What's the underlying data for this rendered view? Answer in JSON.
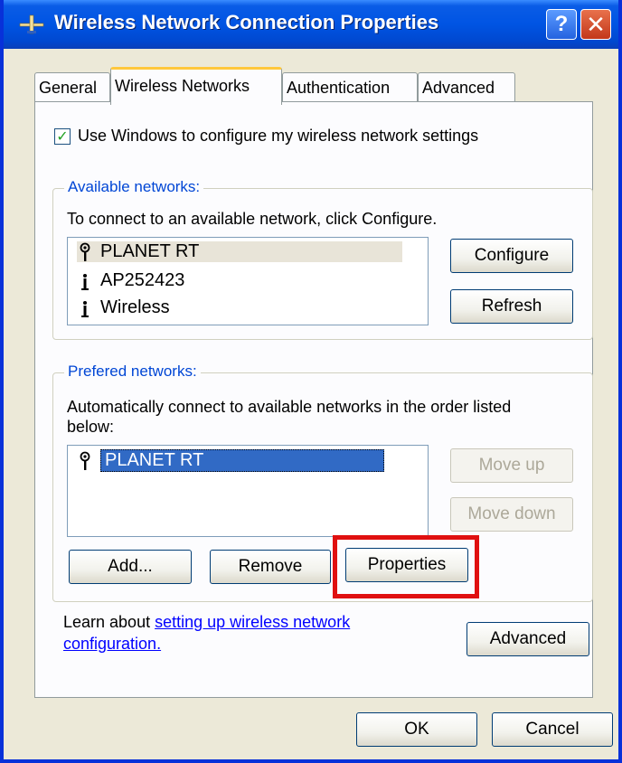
{
  "window": {
    "title": "Wireless Network Connection Properties",
    "help_glyph": "?",
    "close_glyph": "✕"
  },
  "tabs": [
    {
      "label": "General",
      "active": false
    },
    {
      "label": "Wireless Networks",
      "active": true
    },
    {
      "label": "Authentication",
      "active": false
    },
    {
      "label": "Advanced",
      "active": false
    }
  ],
  "settings": {
    "use_windows_label": "Use Windows to configure my wireless network settings",
    "use_windows_checked": true
  },
  "available": {
    "group_title": "Available networks:",
    "instruction": "To connect to an available network, click Configure.",
    "networks": [
      {
        "name": "PLANET RT",
        "icon": "antenna-configured-icon"
      },
      {
        "name": "AP252423",
        "icon": "antenna-icon"
      },
      {
        "name": "Wireless",
        "icon": "antenna-icon"
      }
    ],
    "configure_label": "Configure",
    "refresh_label": "Refresh"
  },
  "preferred": {
    "group_title": "Prefered networks:",
    "instruction_line1": "Automatically connect to available networks in the order listed",
    "instruction_line2": "below:",
    "networks": [
      {
        "name": "PLANET RT",
        "icon": "antenna-configured-icon"
      }
    ],
    "move_up_label": "Move up",
    "move_down_label": "Move down",
    "add_label": "Add...",
    "remove_label": "Remove",
    "properties_label": "Properties"
  },
  "learn": {
    "prefix": "Learn about ",
    "link_line1": "setting up wireless network",
    "link_line2": "configuration."
  },
  "footer": {
    "advanced_label": "Advanced",
    "ok_label": "OK",
    "cancel_label": "Cancel"
  },
  "colors": {
    "title_bar": "#0054e3",
    "highlight_box": "#e01010",
    "selection": "#316ac5",
    "group_title": "#0046d5"
  }
}
